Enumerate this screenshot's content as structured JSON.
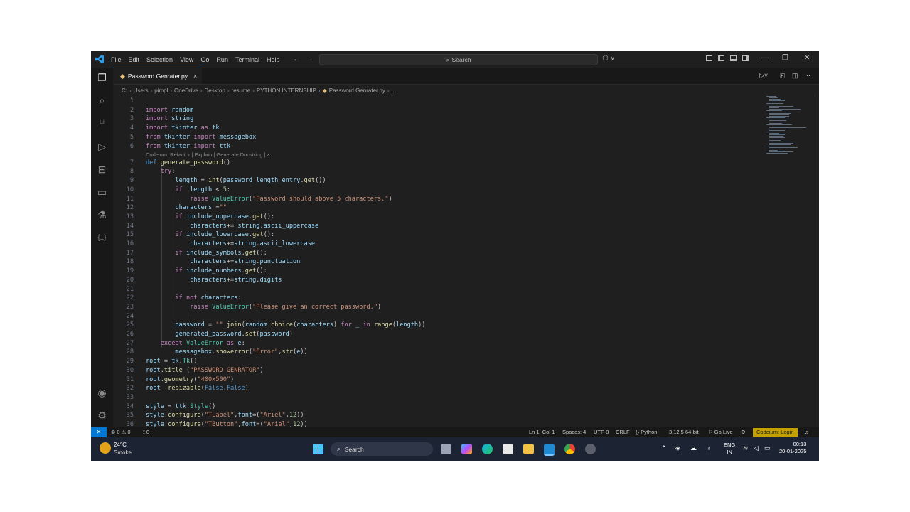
{
  "window": {
    "menu": [
      "File",
      "Edit",
      "Selection",
      "View",
      "Go",
      "Run",
      "Terminal",
      "Help"
    ],
    "search_placeholder": "Search"
  },
  "tab": {
    "label": "Password Genrater.py",
    "close": "×"
  },
  "breadcrumb": [
    "C:",
    "Users",
    "pimpl",
    "OneDrive",
    "Desktop",
    "resume",
    "PYTHON INTERNSHIP",
    "Password Genrater.py",
    "..."
  ],
  "codelens": "Codeium: Refactor | Explain | Generate Docstring | ×",
  "editor": {
    "cursor_line": "1",
    "lines": [
      {
        "n": "1",
        "t": ""
      },
      {
        "n": "2",
        "t": "import random"
      },
      {
        "n": "3",
        "t": "import string"
      },
      {
        "n": "4",
        "t": "import tkinter as tk"
      },
      {
        "n": "5",
        "t": "from tkinter import messagebox"
      },
      {
        "n": "6",
        "t": "from tkinter import ttk"
      },
      {
        "n": "7",
        "t": "def generate_password():"
      },
      {
        "n": "8",
        "t": "    try:"
      },
      {
        "n": "9",
        "t": "        length = int(password_length_entry.get())"
      },
      {
        "n": "10",
        "t": "        if  length < 5:"
      },
      {
        "n": "11",
        "t": "            raise ValueError(\"Password should above 5 characters.\")"
      },
      {
        "n": "12",
        "t": "        characters =\"\""
      },
      {
        "n": "13",
        "t": "        if include_uppercase.get():"
      },
      {
        "n": "14",
        "t": "            characters+= string.ascii_uppercase"
      },
      {
        "n": "15",
        "t": "        if include_lowercase.get():"
      },
      {
        "n": "16",
        "t": "            characters+=string.ascii_lowercase"
      },
      {
        "n": "17",
        "t": "        if include_symbols.get():"
      },
      {
        "n": "18",
        "t": "            characters+=string.punctuation"
      },
      {
        "n": "19",
        "t": "        if include_numbers.get():"
      },
      {
        "n": "20",
        "t": "            characters+=string.digits"
      },
      {
        "n": "21",
        "t": ""
      },
      {
        "n": "22",
        "t": "        if not characters:"
      },
      {
        "n": "23",
        "t": "            raise ValueError(\"Please give an correct password.\")"
      },
      {
        "n": "24",
        "t": ""
      },
      {
        "n": "25",
        "t": "        password = \"\".join(random.choice(characters) for _ in range(length))"
      },
      {
        "n": "26",
        "t": "        generated_password.set(password)"
      },
      {
        "n": "27",
        "t": "    except ValueError as e:"
      },
      {
        "n": "28",
        "t": "        messagebox.showerror(\"Error\",str(e))"
      },
      {
        "n": "29",
        "t": "root = tk.Tk()"
      },
      {
        "n": "30",
        "t": "root.title (\"PASSWORD GENRATOR\")"
      },
      {
        "n": "31",
        "t": "root.geometry(\"400x500\")"
      },
      {
        "n": "32",
        "t": "root .resizable(False,False)"
      },
      {
        "n": "33",
        "t": ""
      },
      {
        "n": "34",
        "t": "style = ttk.Style()"
      },
      {
        "n": "35",
        "t": "style.configure(\"TLabel\",font=(\"Ariel\",12))"
      },
      {
        "n": "36",
        "t": "style.configure(\"TButton\",font=(\"Ariel\",12))"
      }
    ]
  },
  "statusbar": {
    "problems": "⊗ 0 ⚠ 0",
    "ports": "⟟ 0",
    "position": "Ln 1, Col 1",
    "spaces": "Spaces: 4",
    "encoding": "UTF-8",
    "eol": "CRLF",
    "language": "{} Python",
    "interpreter": "3.12.5 64-bit",
    "golive": "⚐ Go Live",
    "codeium": "Codeium: Login"
  },
  "taskbar": {
    "temperature": "24°C",
    "weather": "Smoke",
    "search": "Search",
    "lang_top": "ENG",
    "lang_bottom": "IN",
    "time": "00:13",
    "date": "20-01-2025"
  },
  "colors": {
    "accent": "#0078d4",
    "codeium_badge": "#c4a000",
    "keyword": "#c586c0",
    "builtin": "#569cd6",
    "function": "#dcdcaa",
    "string": "#ce9178"
  }
}
